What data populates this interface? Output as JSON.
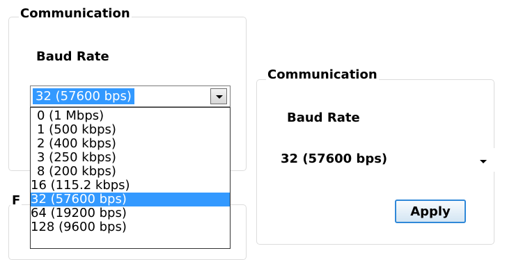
{
  "left_panel": {
    "group_title": "Communication",
    "baud_label": "Baud Rate",
    "combo_value": "32 (57600 bps)",
    "options": [
      "0 (1 Mbps)",
      "1 (500 kbps)",
      "2 (400 kbps)",
      "3 (250 kbps)",
      "8 (200 kbps)",
      "16 (115.2 kbps)",
      "32 (57600 bps)",
      "64 (19200 bps)",
      "128 (9600 bps)"
    ],
    "selected_option": "32 (57600 bps)",
    "second_group_title": "F"
  },
  "right_panel": {
    "group_title": "Communication",
    "baud_label": "Baud Rate",
    "combo_value": "32 (57600 bps)",
    "apply_label": "Apply"
  },
  "colors": {
    "selection": "#3399ff",
    "button_border": "#2f88d8"
  }
}
